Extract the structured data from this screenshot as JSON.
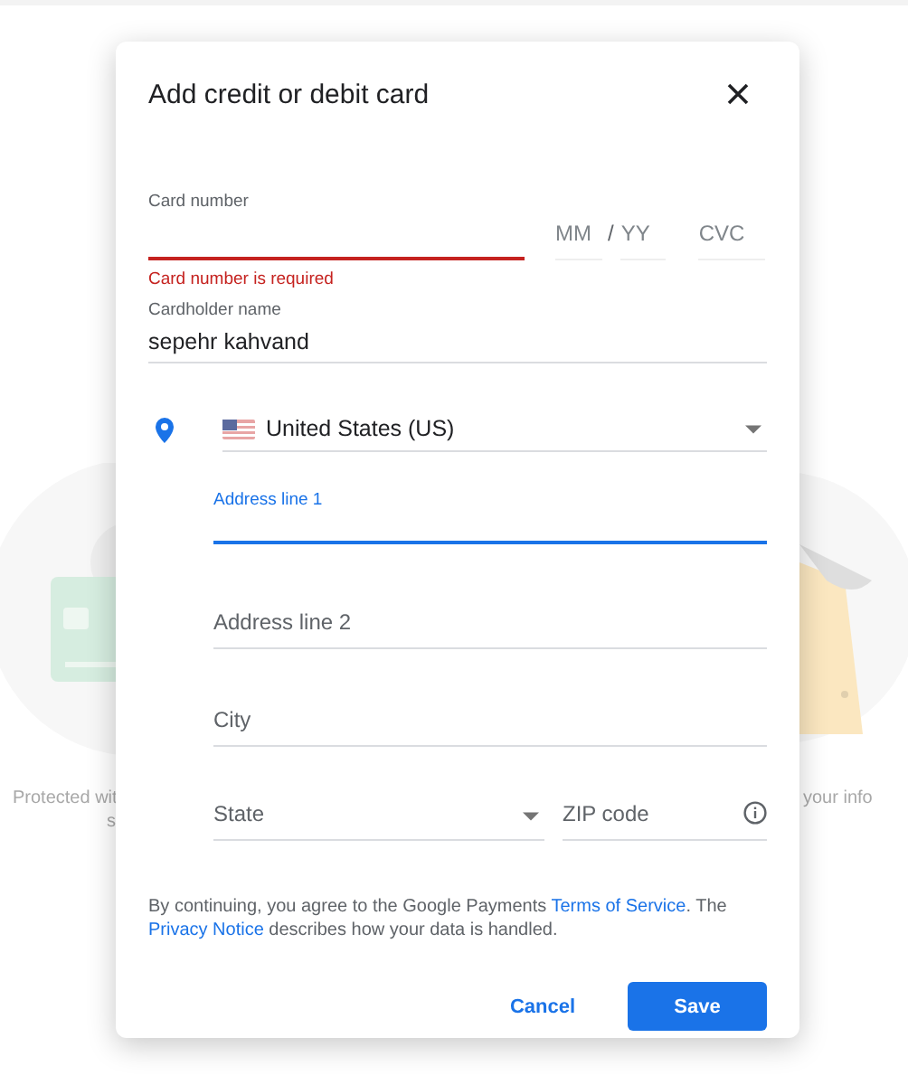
{
  "background": {
    "left_caption": "Protected wit",
    "left_caption_2": "s",
    "right_caption": "your info"
  },
  "dialog": {
    "title": "Add credit or debit card",
    "card_number": {
      "label": "Card number",
      "error": "Card number is required"
    },
    "expiry": {
      "month_placeholder": "MM",
      "separator": "/",
      "year_placeholder": "YY"
    },
    "cvc": {
      "placeholder": "CVC"
    },
    "cardholder": {
      "label": "Cardholder name",
      "value": "sepehr kahvand"
    },
    "country": {
      "value": "United States (US)"
    },
    "address_line_1": {
      "label": "Address line 1",
      "focused": true
    },
    "address_line_2": {
      "placeholder": "Address line 2"
    },
    "city": {
      "placeholder": "City"
    },
    "state": {
      "placeholder": "State"
    },
    "zip": {
      "placeholder": "ZIP code"
    },
    "legal": {
      "before": "By continuing, you agree to the Google Payments ",
      "link_1": "Terms of Service",
      "middle": ". The ",
      "link_2": "Privacy Notice",
      "after": " describes how your data is handled."
    },
    "buttons": [
      {
        "label": "Cancel",
        "kind": "text"
      },
      {
        "label": "Save",
        "kind": "primary"
      }
    ]
  }
}
